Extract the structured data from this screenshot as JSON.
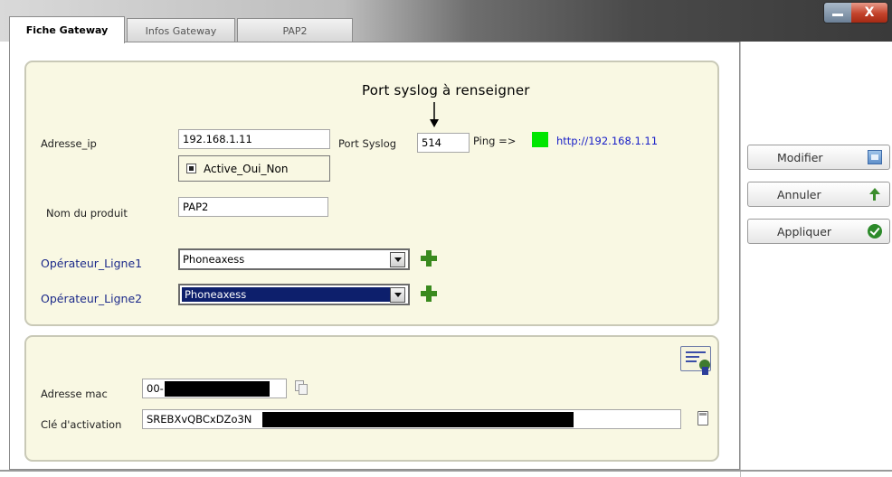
{
  "tabs": [
    {
      "label": "Fiche Gateway",
      "active": true
    },
    {
      "label": "Infos Gateway",
      "active": false
    },
    {
      "label": "PAP2",
      "active": false
    }
  ],
  "window_controls": {
    "close_label": "X"
  },
  "annotation": {
    "text": "Port syslog à renseigner"
  },
  "form": {
    "ip_label": "Adresse_ip",
    "ip_value": "192.168.1.11",
    "syslog_label": "Port Syslog",
    "syslog_value": "514",
    "ping_label": "Ping =>",
    "ping_status_color": "#00e600",
    "http_link": "http://192.168.1.11",
    "active_label": "Active_Oui_Non",
    "product_label": "Nom du produit",
    "product_value": "PAP2",
    "op1_label": "Opérateur_Ligne1",
    "op1_value": "Phoneaxess",
    "op2_label": "Opérateur_Ligne2",
    "op2_value": "Phoneaxess",
    "mac_label": "Adresse mac",
    "mac_value": "00-1",
    "key_label": "Clé d'activation",
    "key_value": "SREBXvQBCxDZo3N"
  },
  "buttons": {
    "modify": "Modifier",
    "cancel": "Annuler",
    "apply": "Appliquer"
  },
  "colors": {
    "panel_bg": "#f9f8e3",
    "link_blue": "#1a20c8",
    "selected_bg": "#0d1f6c",
    "plus_green": "#3a8a1e"
  }
}
